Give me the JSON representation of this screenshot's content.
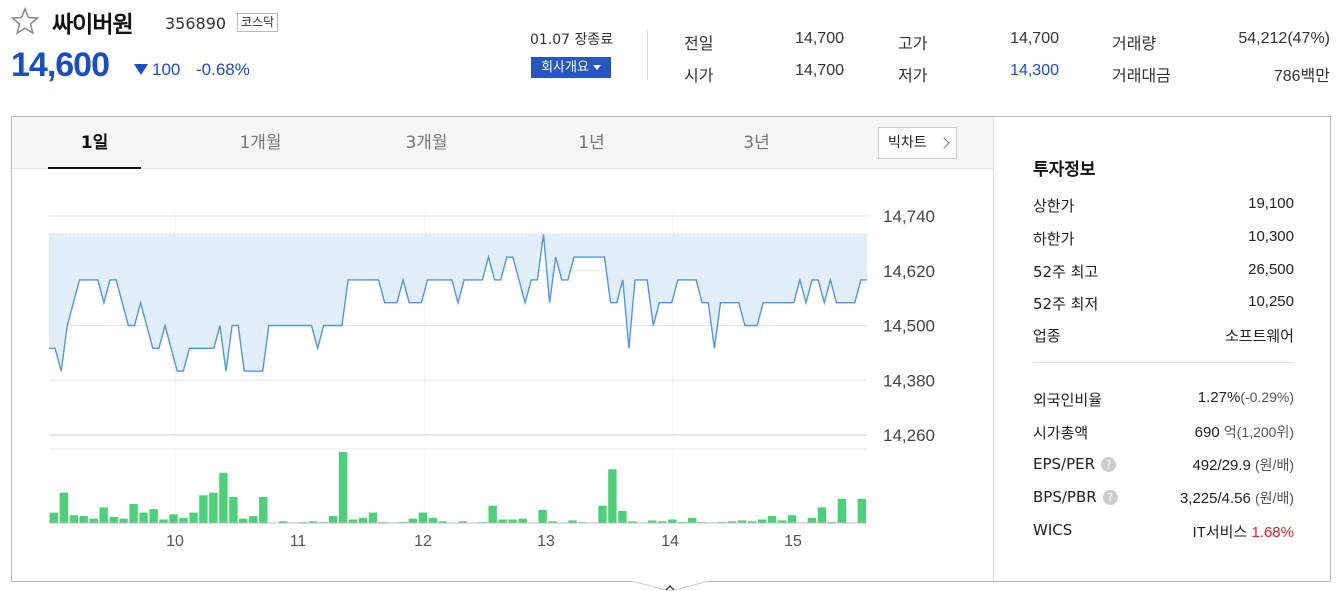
{
  "header": {
    "name": "싸이버원",
    "code": "356890",
    "market": "코스닥",
    "price": "14,600",
    "change_value": "100",
    "change_pct": "-0.68%",
    "close_date": "01.07 장종료",
    "company_button": "회사개요",
    "direction": "down"
  },
  "quote": {
    "prev_label": "전일",
    "prev_value": "14,700",
    "open_label": "시가",
    "open_value": "14,700",
    "high_label": "고가",
    "high_value": "14,700",
    "low_label": "저가",
    "low_value": "14,300",
    "volume_label": "거래량",
    "volume_value": "54,212(47%)",
    "amount_label": "거래대금",
    "amount_value": "786백만"
  },
  "tabs": [
    {
      "label": "1일",
      "active": true
    },
    {
      "label": "1개월",
      "active": false
    },
    {
      "label": "3개월",
      "active": false
    },
    {
      "label": "1년",
      "active": false
    },
    {
      "label": "3년",
      "active": false
    }
  ],
  "big_chart_label": "빅차트",
  "invest": {
    "title": "투자정보",
    "upper_limit_label": "상한가",
    "upper_limit_value": "19,100",
    "lower_limit_label": "하한가",
    "lower_limit_value": "10,300",
    "w52_high_label": "52주 최고",
    "w52_high_value": "26,500",
    "w52_low_label": "52주 최저",
    "w52_low_value": "10,250",
    "industry_label": "업종",
    "industry_value": "소프트웨어",
    "foreign_label": "외국인비율",
    "foreign_value": "1.27%",
    "foreign_sub": "(-0.29%)",
    "mcap_label": "시가총액",
    "mcap_value": "690",
    "mcap_sub": "억(1,200위)",
    "eps_label": "EPS/PER",
    "eps_value": "492/29.9",
    "eps_sub": "(원/배)",
    "bps_label": "BPS/PBR",
    "bps_value": "3,225/4.56",
    "bps_sub": "(원/배)",
    "wics_label": "WICS",
    "wics_value": "IT서비스",
    "wics_pct": "1.68%"
  },
  "chart_data": {
    "type": "line",
    "y_ticks": [
      "14,740",
      "14,620",
      "14,500",
      "14,380",
      "14,260"
    ],
    "ylim": [
      14260,
      14740
    ],
    "baseline": 14700,
    "x_ticks": [
      "10",
      "11",
      "12",
      "13",
      "14",
      "15"
    ],
    "series": [
      {
        "values": [
          14450,
          14450,
          14400,
          14500,
          14550,
          14600,
          14600,
          14600,
          14600,
          14550,
          14600,
          14600,
          14550,
          14500,
          14500,
          14550,
          14500,
          14450,
          14450,
          14500,
          14450,
          14400,
          14400,
          14450,
          14450,
          14450,
          14450,
          14450,
          14500,
          14400,
          14500,
          14500,
          14400,
          14400,
          14400,
          14400,
          14500,
          14500,
          14500,
          14500,
          14500,
          14500,
          14500,
          14500,
          14450,
          14500,
          14500,
          14500,
          14500,
          14600,
          14600,
          14600,
          14600,
          14600,
          14600,
          14550,
          14550,
          14550,
          14600,
          14550,
          14550,
          14550,
          14600,
          14600,
          14600,
          14600,
          14600,
          14550,
          14600,
          14600,
          14600,
          14600,
          14650,
          14600,
          14600,
          14650,
          14650,
          14600,
          14550,
          14600,
          14600,
          14700,
          14550,
          14650,
          14600,
          14600,
          14650,
          14650,
          14650,
          14650,
          14650,
          14650,
          14550,
          14550,
          14600,
          14450,
          14600,
          14600,
          14600,
          14500,
          14550,
          14550,
          14550,
          14600,
          14600,
          14600,
          14600,
          14550,
          14550,
          14450,
          14550,
          14550,
          14550,
          14550,
          14500,
          14500,
          14500,
          14550,
          14550,
          14550,
          14550,
          14550,
          14550,
          14600,
          14550,
          14600,
          14600,
          14550,
          14600,
          14550,
          14550,
          14550,
          14550,
          14600,
          14600
        ]
      }
    ],
    "volume": [
      12,
      35,
      9,
      8,
      5,
      18,
      7,
      5,
      22,
      12,
      16,
      4,
      10,
      6,
      12,
      32,
      35,
      58,
      30,
      5,
      8,
      30,
      0,
      2,
      0,
      1,
      2,
      1,
      8,
      82,
      4,
      6,
      12,
      1,
      0,
      1,
      5,
      12,
      6,
      2,
      0,
      2,
      0,
      1,
      20,
      4,
      4,
      5,
      0,
      15,
      2,
      0,
      3,
      1,
      0,
      20,
      62,
      14,
      2,
      0,
      3,
      2,
      4,
      1,
      6,
      1,
      0,
      1,
      2,
      3,
      2,
      4,
      8,
      3,
      9,
      0,
      6,
      18,
      1,
      28,
      0,
      28
    ]
  }
}
